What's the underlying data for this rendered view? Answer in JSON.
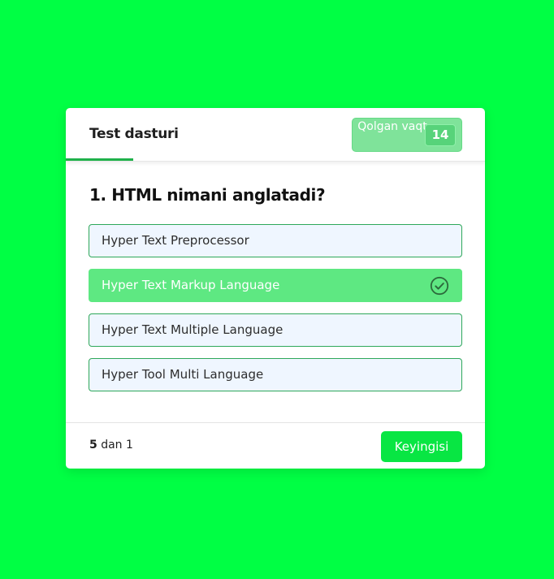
{
  "header": {
    "title": "Test dasturi",
    "timer_label": "Qolgan vaqt",
    "timer_value": "14"
  },
  "question": {
    "text": "1. HTML nimani anglatadi?"
  },
  "options": [
    {
      "label": "Hyper Text Preprocessor",
      "selected": false
    },
    {
      "label": "Hyper Text Markup Language",
      "selected": true
    },
    {
      "label": "Hyper Text Multiple Language",
      "selected": false
    },
    {
      "label": "Hyper Tool Multi Language",
      "selected": false
    }
  ],
  "footer": {
    "progress_total": "5",
    "progress_word": "dan",
    "progress_current": "1",
    "next_label": "Keyingisi"
  },
  "colors": {
    "background": "#00ff44",
    "accent": "#1fb14a",
    "selected_option": "#5ee882",
    "next_button": "#08e643"
  },
  "icons": {
    "selected_option_icon": "check-circle-icon"
  }
}
